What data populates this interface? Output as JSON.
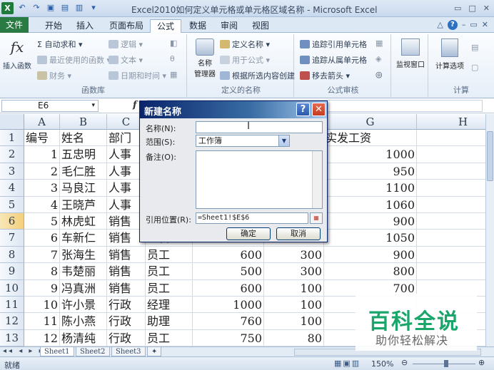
{
  "window": {
    "app_icon": "X",
    "title": "Excel2010如何定义单元格或单元格区域名称 - Microsoft Excel",
    "qat_icons": [
      "undo-icon",
      "redo-icon",
      "save-icon",
      "open-icon",
      "print-preview-icon",
      "customize-icon"
    ],
    "controls": [
      "▭",
      "□",
      "✕"
    ]
  },
  "ribbon": {
    "tabs": [
      "文件",
      "开始",
      "插入",
      "页面布局",
      "公式",
      "数据",
      "审阅",
      "视图"
    ],
    "active_tab": "公式",
    "right_icons": [
      "△",
      "?",
      "–",
      "▭",
      "✕"
    ],
    "function_library": {
      "label": "函数库",
      "insert_function": "插入函数",
      "fx": "fx",
      "autosum": "Σ 自动求和 ▾",
      "recent": "最近使用的函数 ▾",
      "financial": "财务 ▾",
      "logical": "逻辑 ▾",
      "text": "文本 ▾",
      "datetime": "日期和时间 ▾"
    },
    "defined_names": {
      "label": "定义的名称",
      "name_manager_1": "名称",
      "name_manager_2": "管理器",
      "define_name": "定义名称 ▾",
      "use_in_formula": "用于公式 ▾",
      "create_from_selection": "根据所选内容创建"
    },
    "formula_auditing": {
      "label": "公式审核",
      "trace_precedents": "追踪引用单元格",
      "trace_dependents": "追踪从属单元格",
      "remove_arrows": "移去箭头 ▾"
    },
    "watch_window": "监视窗口",
    "calculation": {
      "label": "计算",
      "options": "计算选项"
    }
  },
  "formula_bar": {
    "name_box": "E6",
    "fx": "f"
  },
  "sheet": {
    "columns": [
      "A",
      "B",
      "C",
      "D",
      "E",
      "F",
      "G",
      "H"
    ],
    "selected_column": "E",
    "selected_row": 6,
    "rows": [
      {
        "n": "1",
        "a": "编号",
        "b": "姓名",
        "c": "部门",
        "d": "",
        "e": "",
        "f": "",
        "g": "实发工资"
      },
      {
        "n": "2",
        "a": "1",
        "b": "五忠明",
        "c": "人事",
        "d": "",
        "e": "",
        "f": "",
        "g": "1000"
      },
      {
        "n": "3",
        "a": "2",
        "b": "毛仁胜",
        "c": "人事",
        "d": "",
        "e": "",
        "f": "",
        "g": "950"
      },
      {
        "n": "4",
        "a": "3",
        "b": "马良江",
        "c": "人事",
        "d": "",
        "e": "",
        "f": "",
        "g": "1100"
      },
      {
        "n": "5",
        "a": "4",
        "b": "王晓芦",
        "c": "人事",
        "d": "",
        "e": "",
        "f": "",
        "g": "1060"
      },
      {
        "n": "6",
        "a": "5",
        "b": "林虎虹",
        "c": "销售",
        "d": "",
        "e": "",
        "f": "",
        "g": "900"
      },
      {
        "n": "7",
        "a": "6",
        "b": "车新仁",
        "c": "销售",
        "d": "主管",
        "e": "",
        "f": "",
        "g": "1050"
      },
      {
        "n": "8",
        "a": "7",
        "b": "张海生",
        "c": "销售",
        "d": "员工",
        "e": "600",
        "f": "300",
        "g": "900"
      },
      {
        "n": "9",
        "a": "8",
        "b": "韦楚丽",
        "c": "销售",
        "d": "员工",
        "e": "500",
        "f": "300",
        "g": "800"
      },
      {
        "n": "10",
        "a": "9",
        "b": "冯真洲",
        "c": "销售",
        "d": "员工",
        "e": "600",
        "f": "100",
        "g": "700"
      },
      {
        "n": "11",
        "a": "10",
        "b": "许小景",
        "c": "行政",
        "d": "经理",
        "e": "1000",
        "f": "100",
        "g": ""
      },
      {
        "n": "12",
        "a": "11",
        "b": "陈小燕",
        "c": "行政",
        "d": "助理",
        "e": "760",
        "f": "100",
        "g": ""
      },
      {
        "n": "13",
        "a": "12",
        "b": "杨清纯",
        "c": "行政",
        "d": "员工",
        "e": "750",
        "f": "80",
        "g": ""
      }
    ]
  },
  "sheet_tabs": [
    "Sheet1",
    "Sheet2",
    "Sheet3"
  ],
  "status_bar": {
    "mode": "就绪",
    "zoom": "150%"
  },
  "dialog": {
    "title": "新建名称",
    "help": "?",
    "close": "✕",
    "name_label": "名称(N):",
    "name_value": "",
    "scope_label": "范围(S):",
    "scope_value": "工作簿",
    "comment_label": "备注(O):",
    "ref_label": "引用位置(R):",
    "ref_value": "=Sheet1!$E$6",
    "ok": "确定",
    "cancel": "取消"
  },
  "watermark": {
    "title": "百科全说",
    "subtitle": "助你轻松解决"
  }
}
